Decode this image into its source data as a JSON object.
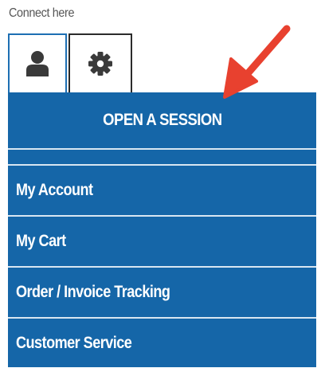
{
  "header": {
    "connect_label": "Connect here"
  },
  "tabs": [
    {
      "icon": "user-icon",
      "active": true
    },
    {
      "icon": "gear-icon",
      "active": false
    }
  ],
  "session": {
    "label": "OPEN A SESSION"
  },
  "menu": {
    "items": [
      {
        "label": "My Account"
      },
      {
        "label": "My Cart"
      },
      {
        "label": "Order / Invoice Tracking"
      },
      {
        "label": "Customer Service"
      }
    ]
  },
  "colors": {
    "menu_background": "#1566a8",
    "divider": "#d8e6f2",
    "active_tab_border": "#1d6fb3",
    "arrow": "#e8412f",
    "icon": "#3a3a3a"
  }
}
